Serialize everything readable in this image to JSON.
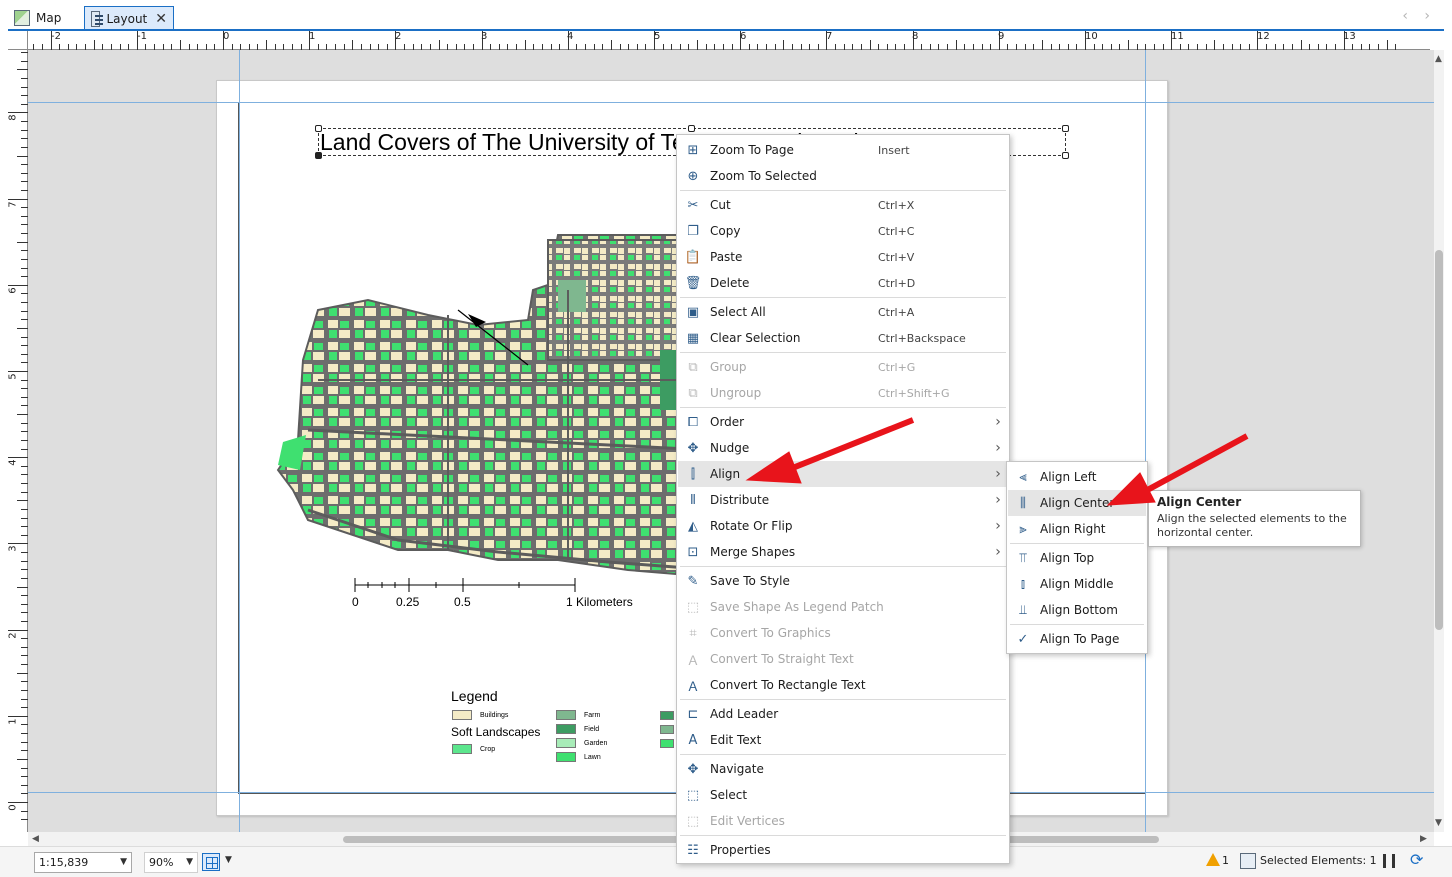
{
  "tabs": [
    {
      "label": "Map",
      "icon": "map-icon"
    },
    {
      "label": "Layout",
      "icon": "layout-icon",
      "close": "✕"
    }
  ],
  "tab_nav": "‹ ›",
  "ruler_top": [
    "-2",
    "-1",
    "0",
    "1",
    "2",
    "3",
    "4",
    "5",
    "6",
    "7",
    "8",
    "9",
    "10",
    "11",
    "12",
    "13"
  ],
  "ruler_left": [
    "8",
    "7",
    "6",
    "5",
    "4",
    "3",
    "2",
    "1",
    "0"
  ],
  "layout": {
    "title": "Land Covers of The University of Texas at Austin Main Campus",
    "scalebar": {
      "ticks": [
        "0",
        "0.25",
        "0.5",
        "1 Kilometers"
      ]
    },
    "legend": {
      "title": "Legend",
      "subtitle": "Soft Landscapes",
      "items": [
        {
          "label": "Buildings",
          "color": "#f4ebc6"
        },
        {
          "label": "Crop",
          "color": "#5ce68d"
        },
        {
          "label": "Farm",
          "color": "#7fb78f"
        },
        {
          "label": "Field",
          "color": "#3d9c62"
        },
        {
          "label": "Garden",
          "color": "#a8ecb8"
        },
        {
          "label": "Lawn",
          "color": "#3fe070"
        }
      ]
    }
  },
  "context_menu": {
    "items": [
      {
        "label": "Zoom To Page",
        "shortcut": "Insert",
        "icon": "zoom-page-icon"
      },
      {
        "label": "Zoom To Selected",
        "shortcut": "",
        "icon": "zoom-selected-icon"
      },
      {
        "label": "Cut",
        "shortcut": "Ctrl+X",
        "icon": "scissors-icon"
      },
      {
        "label": "Copy",
        "shortcut": "Ctrl+C",
        "icon": "copy-icon"
      },
      {
        "label": "Paste",
        "shortcut": "Ctrl+V",
        "icon": "paste-icon"
      },
      {
        "label": "Delete",
        "shortcut": "Ctrl+D",
        "icon": "trash-icon"
      },
      {
        "label": "Select All",
        "shortcut": "Ctrl+A",
        "icon": "select-all-icon"
      },
      {
        "label": "Clear Selection",
        "shortcut": "Ctrl+Backspace",
        "icon": "clear-selection-icon"
      },
      {
        "label": "Group",
        "shortcut": "Ctrl+G",
        "icon": "group-icon",
        "disabled": true
      },
      {
        "label": "Ungroup",
        "shortcut": "Ctrl+Shift+G",
        "icon": "ungroup-icon",
        "disabled": true
      },
      {
        "label": "Order",
        "shortcut": "",
        "icon": "order-icon",
        "submenu": true
      },
      {
        "label": "Nudge",
        "shortcut": "",
        "icon": "nudge-icon",
        "submenu": true
      },
      {
        "label": "Align",
        "shortcut": "",
        "icon": "align-icon",
        "submenu": true,
        "highlighted": true
      },
      {
        "label": "Distribute",
        "shortcut": "",
        "icon": "distribute-icon",
        "submenu": true
      },
      {
        "label": "Rotate Or Flip",
        "shortcut": "",
        "icon": "rotate-flip-icon",
        "submenu": true
      },
      {
        "label": "Merge Shapes",
        "shortcut": "",
        "icon": "merge-shapes-icon",
        "submenu": true
      },
      {
        "label": "Save To Style",
        "shortcut": "",
        "icon": "save-style-icon"
      },
      {
        "label": "Save Shape As Legend Patch",
        "shortcut": "",
        "icon": "legend-patch-icon",
        "disabled": true
      },
      {
        "label": "Convert To Graphics",
        "shortcut": "",
        "icon": "convert-graphics-icon",
        "disabled": true
      },
      {
        "label": "Convert To Straight Text",
        "shortcut": "",
        "icon": "straight-text-icon",
        "disabled": true
      },
      {
        "label": "Convert To Rectangle Text",
        "shortcut": "",
        "icon": "rectangle-text-icon"
      },
      {
        "label": "Add Leader",
        "shortcut": "",
        "icon": "add-leader-icon"
      },
      {
        "label": "Edit Text",
        "shortcut": "",
        "icon": "edit-text-icon"
      },
      {
        "label": "Navigate",
        "shortcut": "",
        "icon": "navigate-icon"
      },
      {
        "label": "Select",
        "shortcut": "",
        "icon": "select-icon"
      },
      {
        "label": "Edit Vertices",
        "shortcut": "",
        "icon": "edit-vertices-icon",
        "disabled": true
      },
      {
        "label": "Properties",
        "shortcut": "",
        "icon": "properties-icon"
      }
    ]
  },
  "align_submenu": {
    "items": [
      {
        "label": "Align Left",
        "icon": "align-left-icon"
      },
      {
        "label": "Align Center",
        "icon": "align-center-icon",
        "highlighted": true
      },
      {
        "label": "Align Right",
        "icon": "align-right-icon"
      },
      {
        "label": "Align Top",
        "icon": "align-top-icon"
      },
      {
        "label": "Align Middle",
        "icon": "align-middle-icon"
      },
      {
        "label": "Align Bottom",
        "icon": "align-bottom-icon"
      },
      {
        "label": "Align To Page",
        "icon": "check-icon",
        "checked": true
      }
    ]
  },
  "tooltip": {
    "title": "Align Center",
    "body": "Align the selected elements to the horizontal center."
  },
  "statusbar": {
    "scale": "1:15,839",
    "zoom": "90%",
    "warnings": "1",
    "selected_elements": "Selected Elements: 1"
  },
  "colors": {
    "accent": "#1b6fc5",
    "highlight": "#e5e5e5",
    "annotation_arrow": "#e8141b",
    "map_building": "#f4ebc6",
    "map_green": "#3fe070",
    "map_road": "#6d6d6d"
  }
}
